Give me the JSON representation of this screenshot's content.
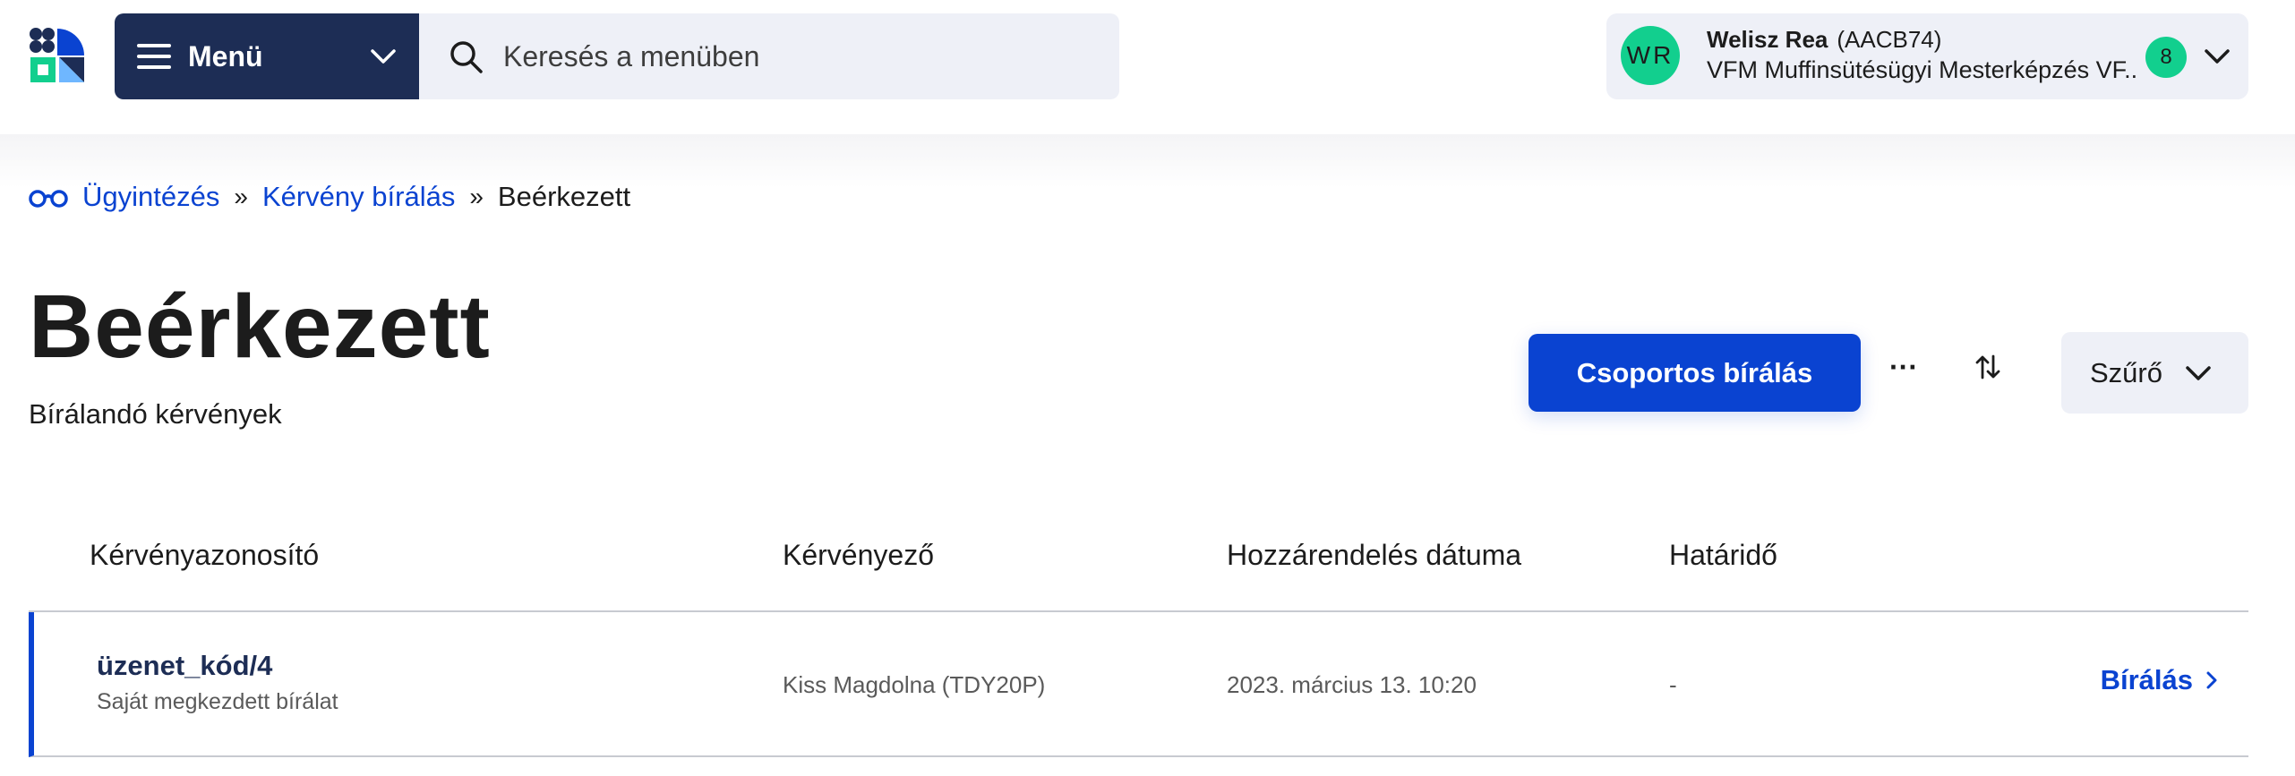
{
  "header": {
    "menu_label": "Menü",
    "search_placeholder": "Keresés a menüben",
    "user": {
      "initials": "WR",
      "name": "Welisz Rea",
      "code": "(AACB74)",
      "organization": "VFM Muffinsütésügyi Mesterképzés VF...",
      "notification_count": "8"
    }
  },
  "breadcrumb": {
    "items": [
      "Ügyintézés",
      "Kérvény bírálás"
    ],
    "current": "Beérkezett",
    "separator": "»"
  },
  "page": {
    "title": "Beérkezett",
    "subtitle": "Bírálandó kérvények"
  },
  "actions": {
    "group_review_label": "Csoportos bírálás",
    "more_label": "···",
    "filter_label": "Szűrő"
  },
  "table": {
    "columns": [
      "Kérvényazonosító",
      "Kérvényező",
      "Hozzárendelés dátuma",
      "Határidő"
    ],
    "rows": [
      {
        "id": "üzenet_kód/4",
        "status": "Saját megkezdett bírálat",
        "applicant": "Kiss Magdolna (TDY20P)",
        "assigned_date": "2023. március 13. 10:20",
        "deadline": "-",
        "action_label": "Bírálás"
      }
    ]
  },
  "colors": {
    "primary": "#0a43d1",
    "navy": "#1d2d55",
    "accent_green": "#12cf8e",
    "light_bg": "#eef0f7"
  }
}
